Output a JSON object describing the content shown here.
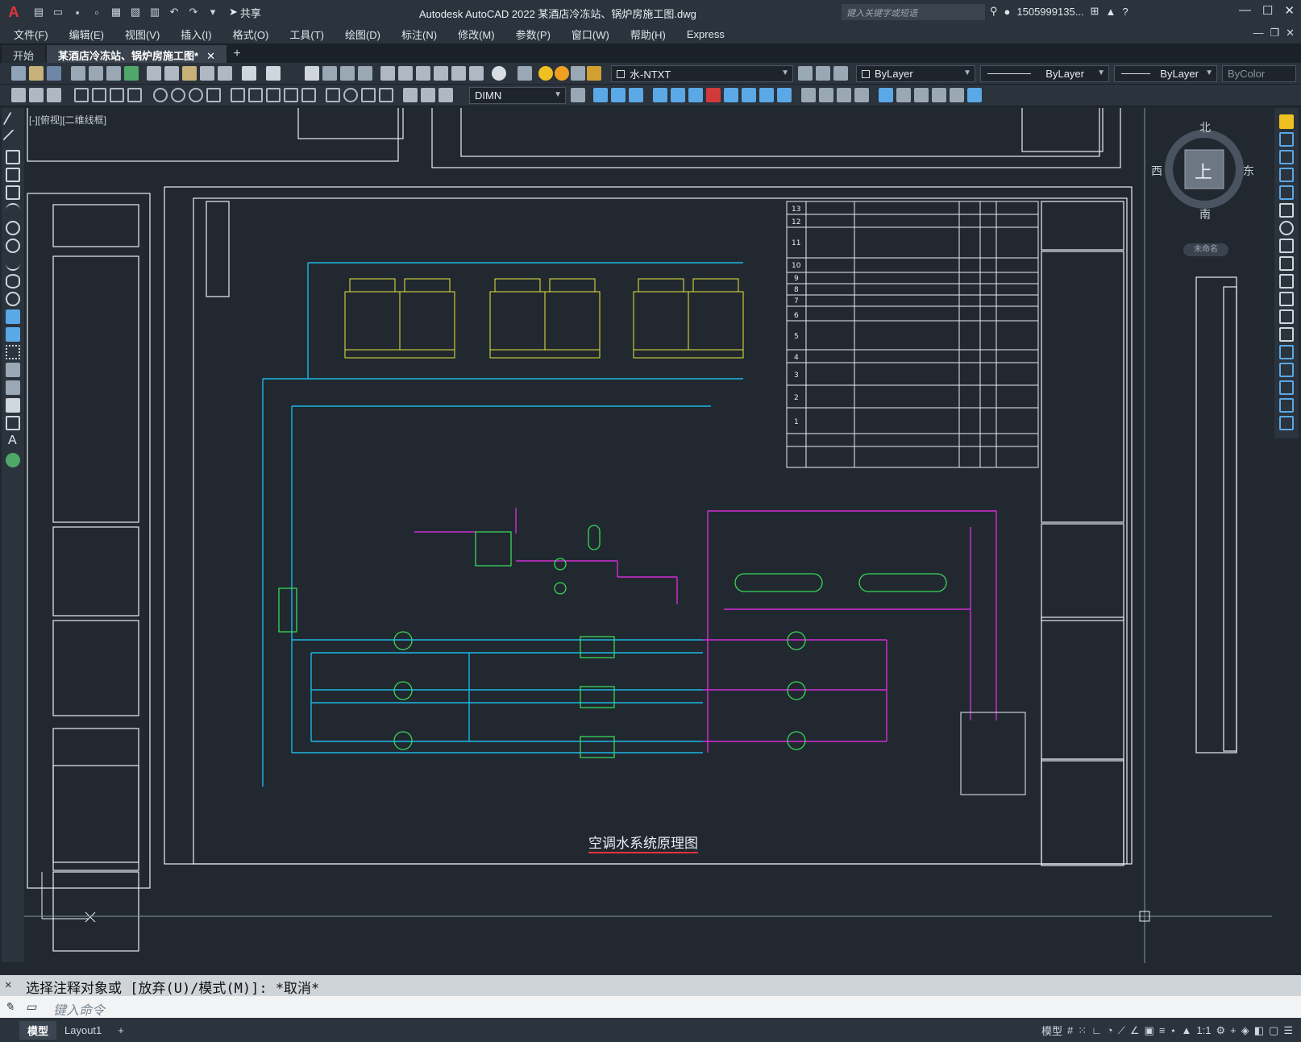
{
  "app": {
    "title": "Autodesk AutoCAD 2022    某酒店冷冻站、锅炉房施工图.dwg",
    "logo": "A",
    "share_label": "共享"
  },
  "search": {
    "placeholder": "键入关键字或短语"
  },
  "user": {
    "name": "1505999135...",
    "help": "?"
  },
  "menu": [
    "文件(F)",
    "编辑(E)",
    "视图(V)",
    "插入(I)",
    "格式(O)",
    "工具(T)",
    "绘图(D)",
    "标注(N)",
    "修改(M)",
    "参数(P)",
    "窗口(W)",
    "帮助(H)",
    "Express"
  ],
  "tabs": [
    {
      "label": "开始"
    },
    {
      "label": "某酒店冷冻站、锅炉房施工图*",
      "close": "✕"
    }
  ],
  "toolbar": {
    "layer": "水-NTXT",
    "color": "ByLayer",
    "linetype": "ByLayer",
    "lineweight": "ByLayer",
    "plotstyle": "ByColor",
    "dimstyle": "DIMN"
  },
  "viewport": {
    "label": "[-][俯视][二维线框]"
  },
  "navcube": {
    "north": "北",
    "south": "南",
    "east": "东",
    "west": "西",
    "top": "上",
    "named_view": "未命名"
  },
  "drawing": {
    "title": "空调水系统原理图",
    "equipment_rows": [
      "13",
      "12",
      "11",
      "10",
      "9",
      "8",
      "7",
      "6",
      "5",
      "4",
      "3",
      "2",
      "1"
    ]
  },
  "command": {
    "history": "选择注释对象或 [放弃(U)/模式(M)]: *取消*",
    "placeholder": "键入命令"
  },
  "status": {
    "layouts": [
      "模型",
      "Layout1"
    ],
    "model_label": "模型",
    "scale": "1:1"
  },
  "colors": {
    "background": "#212830",
    "cyan": "#1cb7e6",
    "magenta": "#d22ed6",
    "yellow": "#e8e63a",
    "green": "#3ad65a",
    "white": "#e9eef3"
  }
}
